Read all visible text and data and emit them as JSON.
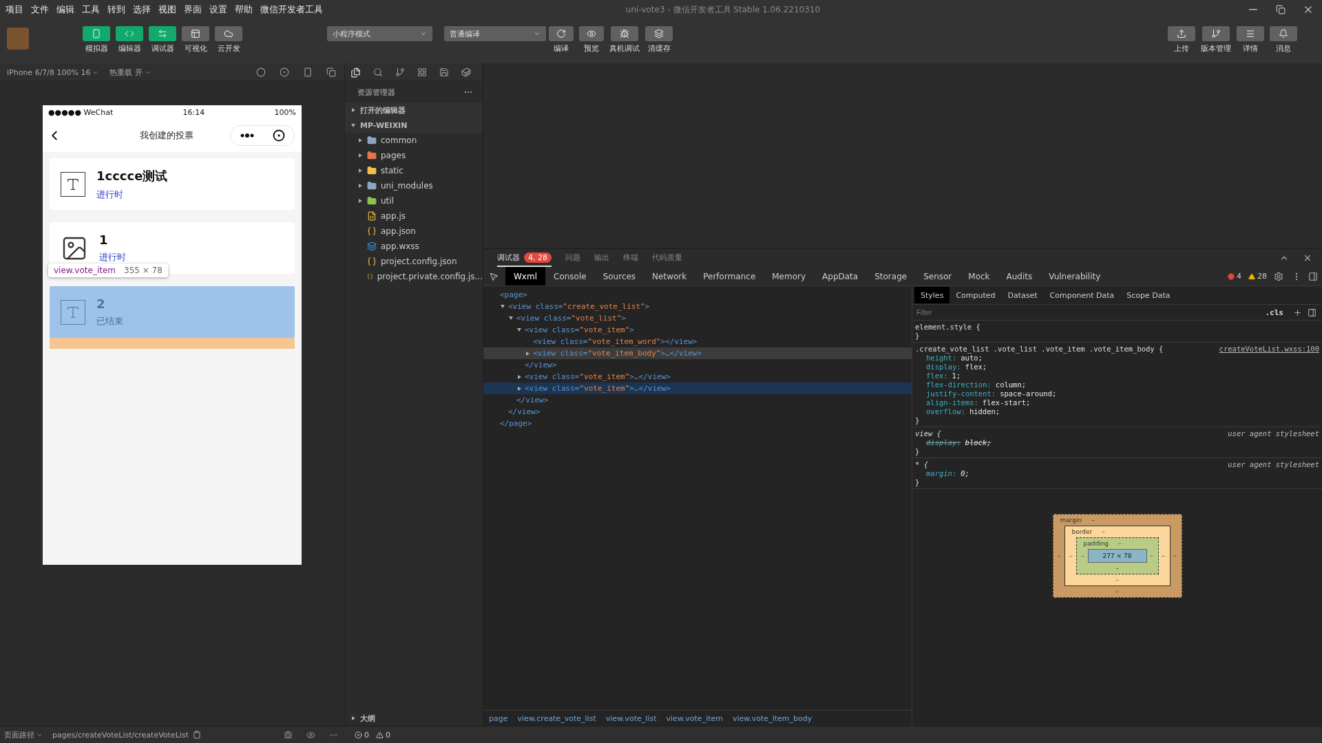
{
  "menu": [
    "项目",
    "文件",
    "编辑",
    "工具",
    "转到",
    "选择",
    "视图",
    "界面",
    "设置",
    "帮助",
    "微信开发者工具"
  ],
  "window": {
    "title": "uni-vote3 - 微信开发者工具 Stable 1.06.2210310"
  },
  "toolbar": {
    "views": [
      {
        "label": "模拟器",
        "on": true
      },
      {
        "label": "编辑器",
        "on": true
      },
      {
        "label": "调试器",
        "on": true
      },
      {
        "label": "可视化",
        "on": false
      },
      {
        "label": "云开发",
        "on": false
      }
    ],
    "mode": "小程序模式",
    "compile": "普通编译",
    "actions": [
      {
        "label": "编译"
      },
      {
        "label": "预览"
      },
      {
        "label": "真机调试"
      },
      {
        "label": "清缓存"
      }
    ],
    "right": [
      {
        "label": "上传"
      },
      {
        "label": "版本管理"
      },
      {
        "label": "详情"
      },
      {
        "label": "消息"
      }
    ]
  },
  "simulator": {
    "device": "iPhone 6/7/8 100% 16",
    "hot_reload": "热重载 开"
  },
  "phone": {
    "signal": "●●●●●",
    "carrier": "WeChat",
    "time": "16:14",
    "battery": "100%",
    "title": "我创建的投票",
    "items": [
      {
        "kind": "text",
        "title": "1cccce测试",
        "status": "进行时",
        "ended": false,
        "highlighted": false
      },
      {
        "kind": "image",
        "title": "1",
        "status": "进行时",
        "ended": false,
        "highlighted": false
      },
      {
        "kind": "text",
        "title": "2",
        "status": "已结束",
        "ended": true,
        "highlighted": true
      }
    ],
    "tooltip": {
      "selector": "view.vote_item",
      "size": "355 × 78"
    }
  },
  "explorer": {
    "title": "资源管理器",
    "sections": [
      {
        "label": "打开的编辑器",
        "expanded": false
      },
      {
        "label": "MP-WEIXIN",
        "expanded": true,
        "children": [
          {
            "name": "common",
            "kind": "folder",
            "color": "#8ea6c4"
          },
          {
            "name": "pages",
            "kind": "folder",
            "color": "#e8744f"
          },
          {
            "name": "static",
            "kind": "folder",
            "color": "#f2c14e"
          },
          {
            "name": "uni_modules",
            "kind": "folder",
            "color": "#8ea6c4"
          },
          {
            "name": "util",
            "kind": "folder",
            "color": "#8cc152"
          },
          {
            "name": "app.js",
            "kind": "js"
          },
          {
            "name": "app.json",
            "kind": "json"
          },
          {
            "name": "app.wxss",
            "kind": "wxss"
          },
          {
            "name": "project.config.json",
            "kind": "json"
          },
          {
            "name": "project.private.config.js...",
            "kind": "json"
          }
        ]
      }
    ],
    "outline": {
      "label": "大纲",
      "expanded": false
    }
  },
  "devtools": {
    "tabs": [
      {
        "label": "调试器",
        "selected": true,
        "badge": "4, 28"
      },
      {
        "label": "问题",
        "selected": false
      },
      {
        "label": "输出",
        "selected": false
      },
      {
        "label": "终端",
        "selected": false
      },
      {
        "label": "代码质量",
        "selected": false
      }
    ],
    "panels": [
      {
        "label": "Wxml",
        "selected": true
      },
      {
        "label": "Console",
        "selected": false
      },
      {
        "label": "Sources",
        "selected": false
      },
      {
        "label": "Network",
        "selected": false
      },
      {
        "label": "Performance",
        "selected": false
      },
      {
        "label": "Memory",
        "selected": false
      },
      {
        "label": "AppData",
        "selected": false
      },
      {
        "label": "Storage",
        "selected": false
      },
      {
        "label": "Sensor",
        "selected": false
      },
      {
        "label": "Mock",
        "selected": false
      },
      {
        "label": "Audits",
        "selected": false
      },
      {
        "label": "Vulnerability",
        "selected": false
      }
    ],
    "errors": "4",
    "warnings": "28",
    "wxml": [
      {
        "kind": "root",
        "open": "<page>",
        "close": "</page>",
        "selected": false,
        "hovered": false,
        "children": [
          {
            "kind": "branch",
            "expanded": true,
            "open": "<view class=\"create_vote_list\">",
            "close": "</view>",
            "selected": false,
            "hovered": false,
            "children": [
              {
                "kind": "branch",
                "expanded": true,
                "open": "<view class=\"vote_list\">",
                "close": "</view>",
                "selected": false,
                "hovered": false,
                "children": [
                  {
                    "kind": "branch",
                    "expanded": true,
                    "open": "<view class=\"vote_item\">",
                    "close": "</view>",
                    "selected": false,
                    "hovered": false,
                    "children": [
                      {
                        "kind": "leaf",
                        "open": "<view class=\"vote_item_word\"></view>",
                        "selected": false,
                        "hovered": false
                      },
                      {
                        "kind": "branch",
                        "expanded": false,
                        "open": "<view class=\"vote_item_body\">…</view>",
                        "selected": true,
                        "hovered": false
                      }
                    ]
                  },
                  {
                    "kind": "branch",
                    "expanded": false,
                    "open": "<view class=\"vote_item\">…</view>",
                    "selected": false,
                    "hovered": false
                  },
                  {
                    "kind": "branch",
                    "expanded": false,
                    "open": "<view class=\"vote_item\">…</view>",
                    "selected": false,
                    "hovered": true
                  }
                ]
              }
            ]
          }
        ]
      }
    ],
    "breadcrumbs": [
      "page",
      "view.create_vote_list",
      "view.vote_list",
      "view.vote_item",
      "view.vote_item_body"
    ],
    "style_tabs": [
      {
        "label": "Styles",
        "selected": true
      },
      {
        "label": "Computed",
        "selected": false
      },
      {
        "label": "Dataset",
        "selected": false
      },
      {
        "label": "Component Data",
        "selected": false
      },
      {
        "label": "Scope Data",
        "selected": false
      }
    ],
    "filter_placeholder": "Filter",
    "cls": ".cls",
    "rules": [
      {
        "kind": "inline",
        "selector": "element.style {",
        "close": "}"
      },
      {
        "kind": "author",
        "selector": ".create_vote_list .vote_list .vote_item .vote_item_body {",
        "origin": "createVoteList.wxss:100",
        "close": "}",
        "declarations": [
          {
            "prop": "height:",
            "value": "auto;",
            "struck": false
          },
          {
            "prop": "display:",
            "value": "flex;",
            "struck": false
          },
          {
            "prop": "flex:",
            "value": "1;",
            "struck": false
          },
          {
            "prop": "flex-direction:",
            "value": "column;",
            "struck": false
          },
          {
            "prop": "justify-content:",
            "value": "space-around;",
            "struck": false
          },
          {
            "prop": "align-items:",
            "value": "flex-start;",
            "struck": false
          },
          {
            "prop": "overflow:",
            "value": "hidden;",
            "struck": false
          }
        ]
      },
      {
        "kind": "agent",
        "selector": "view {",
        "origin": "user agent stylesheet",
        "close": "}",
        "declarations": [
          {
            "prop": "display:",
            "value": "block;",
            "struck": true
          }
        ]
      },
      {
        "kind": "agent",
        "selector": "* {",
        "origin": "user agent stylesheet",
        "close": "}",
        "declarations": [
          {
            "prop": "margin:",
            "value": "0;",
            "struck": false
          }
        ]
      }
    ],
    "box_model": {
      "margin": {
        "label": "margin",
        "top": "–",
        "left": "–",
        "right": "–",
        "bottom": "–"
      },
      "border": {
        "label": "border",
        "top": "–",
        "left": "–",
        "right": "–",
        "bottom": "–"
      },
      "padding": {
        "label": "padding",
        "top": "–",
        "left": "–",
        "right": "–",
        "bottom": "–"
      },
      "content": "277 × 78"
    }
  },
  "status_bar": {
    "path_label": "页面路径",
    "path": "pages/createVoteList/createVoteList",
    "errors": "0",
    "warnings": "0"
  }
}
